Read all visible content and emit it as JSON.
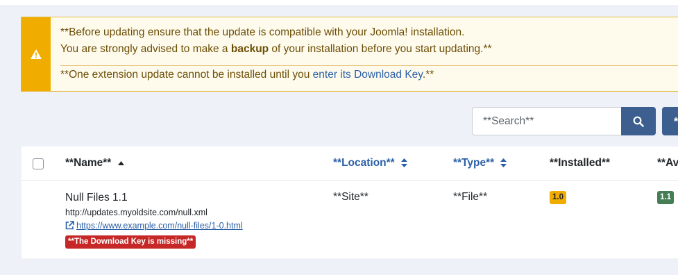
{
  "alert": {
    "icon": "warning-icon",
    "line1": "**Before updating ensure that the update is compatible with your Joomla! installation.",
    "line2_before": "You are strongly advised to make a ",
    "line2_bold": "backup",
    "line2_after": " of your installation before you start updating.**",
    "line3_before": "**One extension update cannot be installed until you ",
    "line3_link": "enter its Download Key",
    "line3_after": ".**",
    "accent_color": "#f0ad00"
  },
  "search": {
    "placeholder": "**Search**",
    "button_icon": "search-icon",
    "extra_button_label": "*"
  },
  "table": {
    "headers": {
      "name": "**Name**",
      "location": "**Location**",
      "type": "**Type**",
      "installed": "**Installed**",
      "available": "**Av"
    },
    "rows": [
      {
        "name": "Null Files 1.1",
        "update_url": "http://updates.myoldsite.com/null.xml",
        "info_url": "https://www.example.com/null-files/1-0.html",
        "warning_badge": "**The Download Key is missing**",
        "location": "**Site**",
        "type": "**File**",
        "installed_version": "1.0",
        "available_version": "1.1"
      }
    ]
  },
  "colors": {
    "link": "#2a5fa7",
    "primary_button": "#3c5f8f",
    "danger_badge": "#c52827",
    "success_badge": "#457d54",
    "warning_badge": "#f0ad00"
  }
}
